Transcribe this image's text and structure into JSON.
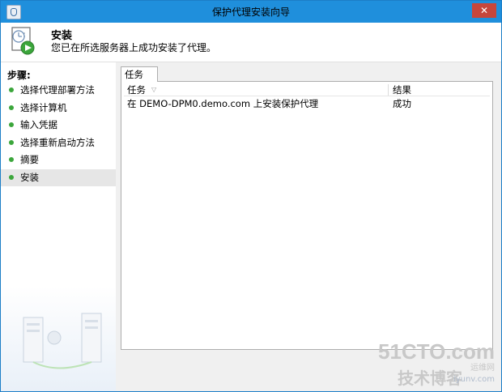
{
  "window": {
    "title": "保护代理安装向导",
    "close_glyph": "✕"
  },
  "header": {
    "title": "安装",
    "subtitle": "您已在所选服务器上成功安装了代理。"
  },
  "steps": {
    "heading": "步骤:",
    "items": [
      {
        "label": "选择代理部署方法"
      },
      {
        "label": "选择计算机"
      },
      {
        "label": "输入凭据"
      },
      {
        "label": "选择重新启动方法"
      },
      {
        "label": "摘要"
      },
      {
        "label": "安装"
      }
    ],
    "active_index": 5,
    "dot_color": "#3ba63b"
  },
  "content": {
    "tab_label": "任务",
    "columns": {
      "task": "任务",
      "result": "结果"
    },
    "rows": [
      {
        "task": "在 DEMO-DPM0.demo.com 上安装保护代理",
        "result": "成功"
      }
    ]
  },
  "watermark": {
    "top": "51CTO.com",
    "mid": "运维网",
    "bottom": "技术博客",
    "url": "iyunv.com"
  },
  "colors": {
    "titlebar": "#1f8fdc",
    "close": "#c7463b"
  }
}
